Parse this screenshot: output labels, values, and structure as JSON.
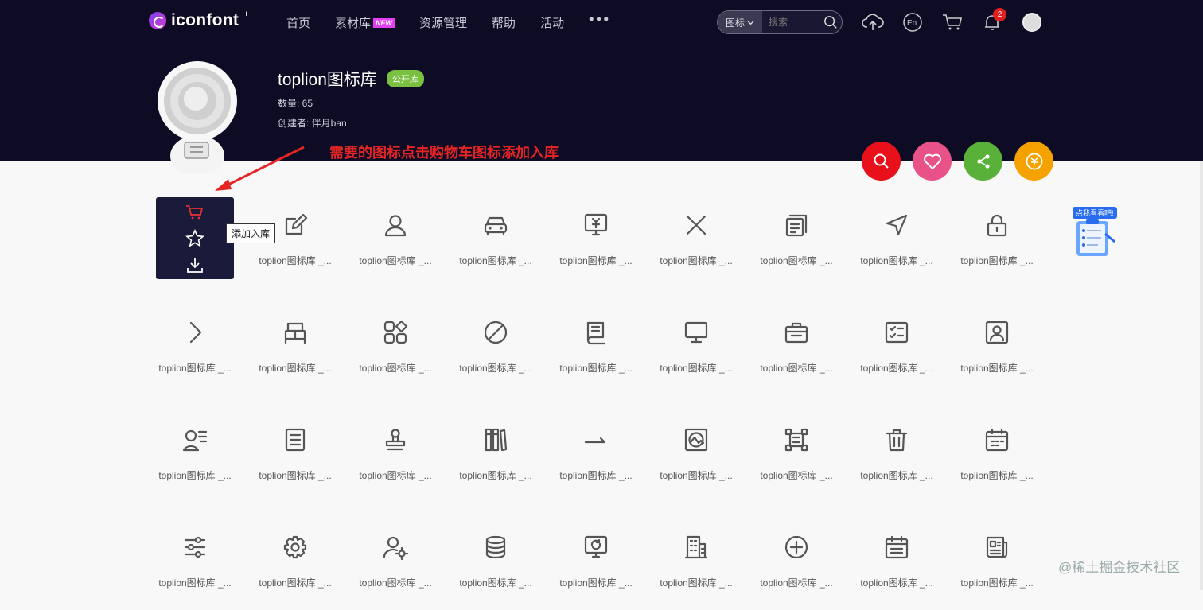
{
  "nav": {
    "logo_text": "iconfont",
    "logo_sup": "+",
    "menu": [
      "首页",
      "素材库",
      "资源管理",
      "帮助",
      "活动"
    ],
    "new_badge": "NEW",
    "more": "•••",
    "search_type": "图标",
    "search_placeholder": "搜索",
    "notification_count": "2"
  },
  "library": {
    "title": "toplion图标库",
    "visibility": "公开库",
    "count_label": "数量: 65",
    "creator_label": "创建者: 伴月ban"
  },
  "annotation": "需要的图标点击购物车图标添加入库",
  "actions": [
    {
      "name": "search",
      "color": "#e8101a"
    },
    {
      "name": "favorite",
      "color": "#e85289"
    },
    {
      "name": "share",
      "color": "#5ab13a"
    },
    {
      "name": "reward",
      "color": "#f5a100"
    }
  ],
  "hover_card": {
    "tooltip": "添加入库"
  },
  "icon_label": "toplion图标库 _...",
  "icons": [
    [
      "cart",
      "edit",
      "user",
      "car",
      "money-monitor",
      "close",
      "copy",
      "navigate",
      "lock"
    ],
    [
      "chevron-right",
      "bed",
      "apps",
      "forbidden",
      "book",
      "monitor",
      "briefcase",
      "checklist",
      "portrait"
    ],
    [
      "user-list",
      "document",
      "stamp",
      "books",
      "arrow-right",
      "image",
      "crop",
      "trash",
      "calendar"
    ],
    [
      "sliders",
      "gear",
      "user-settings",
      "database",
      "refresh-screen",
      "building",
      "plus-circle",
      "calendar-list",
      "newspaper"
    ]
  ],
  "float_widget": {
    "tag": "点我看看吧!"
  },
  "watermark": "@稀土掘金技术社区",
  "colors": {
    "header_bg": "#0e0b24",
    "page_bg": "#f8f8f8",
    "icon": "#555555"
  }
}
